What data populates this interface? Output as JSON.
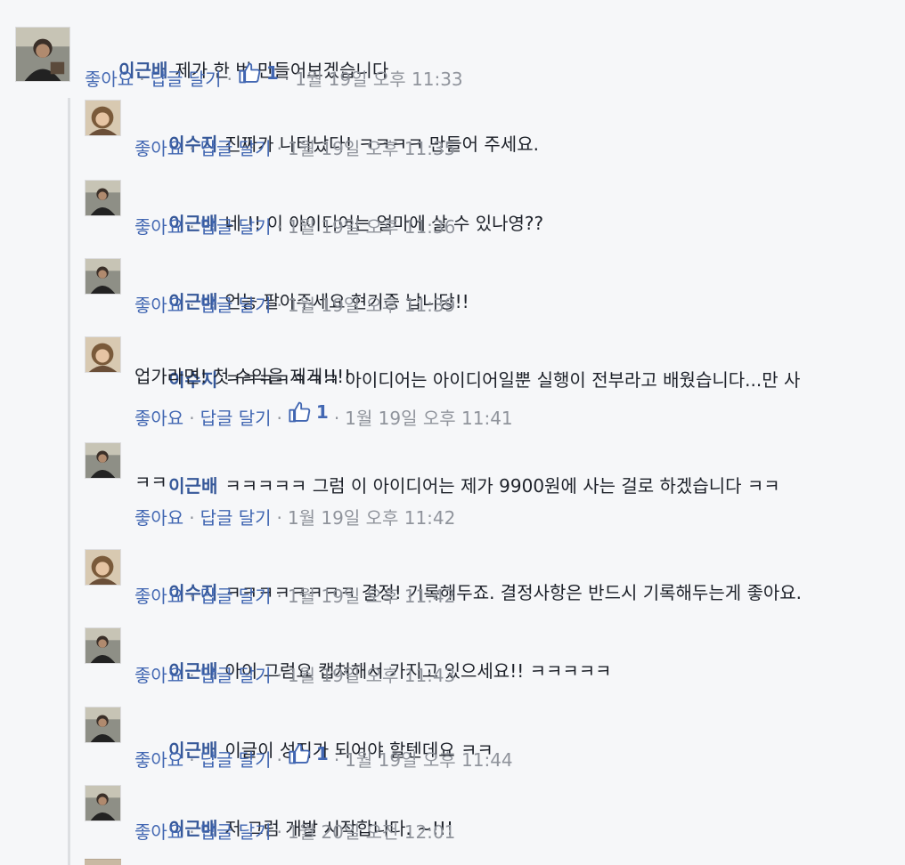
{
  "comments": [
    {
      "author": "이근배",
      "text": "제가 한 번 만들어보겠습니다",
      "like_label": "좋아요",
      "reply_label": "답글 달기",
      "likes": "1",
      "time": "1월 19일 오후 11:33"
    },
    {
      "author": "이수지",
      "text": "진짜가 나타났다! ㅋㅋㅋㅋ 만들어 주세요.",
      "like_label": "좋아요",
      "reply_label": "답글 달기",
      "time": "1월 19일 오후 11:35"
    },
    {
      "author": "이근배",
      "text": "네 !! 이 아이디어는 얼마에 살 수 있나영??",
      "like_label": "좋아요",
      "reply_label": "답글 달기",
      "time": "1월 19일 오후 11:36"
    },
    {
      "author": "이근배",
      "text": "언능 팔아주세요 현기증 납니당!!",
      "like_label": "좋아요",
      "reply_label": "답글 달기",
      "time": "1월 19일 오후 11:39"
    },
    {
      "author": "이수지",
      "text": "ㅋㅋㅋㅋㅋㅋㅋ 아이디어는 아이디어일뿐 실행이 전부라고 배웠습니다...만 사",
      "text_line2": "업가라면! 첫 수익을 제게!!!!",
      "like_label": "좋아요",
      "reply_label": "답글 달기",
      "likes": "1",
      "time": "1월 19일 오후 11:41"
    },
    {
      "author": "이근배",
      "text": "ㅋㅋㅋㅋㅋ 그럼 이 아이디어는 제가 9900원에 사는 걸로 하겠습니다 ㅋㅋ",
      "text_line2": "ㅋㅋ",
      "like_label": "좋아요",
      "reply_label": "답글 달기",
      "time": "1월 19일 오후 11:42"
    },
    {
      "author": "이수지",
      "text": "ㅋㅋㅋㅋㅋㅋㅋㅋ 결정! 기록해두죠. 결정사항은 반드시 기록해두는게 좋아요.",
      "like_label": "좋아요",
      "reply_label": "답글 달기",
      "time": "1월 19일 오후 11:42"
    },
    {
      "author": "이근배",
      "text": "아이 그럼요 캡쳐해서 가지고 있으세요!! ㅋㅋㅋㅋㅋ",
      "like_label": "좋아요",
      "reply_label": "답글 달기",
      "time": "1월 19일 오후 11:43"
    },
    {
      "author": "이근배",
      "text": "이글이 성지가 되어야 할텐데요 ㅋㅋ",
      "like_label": "좋아요",
      "reply_label": "답글 달기",
      "likes": "1",
      "time": "1월 19일 오후 11:44"
    },
    {
      "author": "이근배",
      "text": "저 그럼 개발 시작합니다. ~!!!",
      "like_label": "좋아요",
      "reply_label": "답글 달기",
      "time": "1월 20일 오전 12:01"
    }
  ],
  "separator": "·",
  "colors": {
    "author": "#365899",
    "link": "#4267b2",
    "meta": "#90949c",
    "text": "#1d2129",
    "background": "#f6f7f9"
  },
  "icons": {
    "like": "thumbs-up-icon"
  }
}
